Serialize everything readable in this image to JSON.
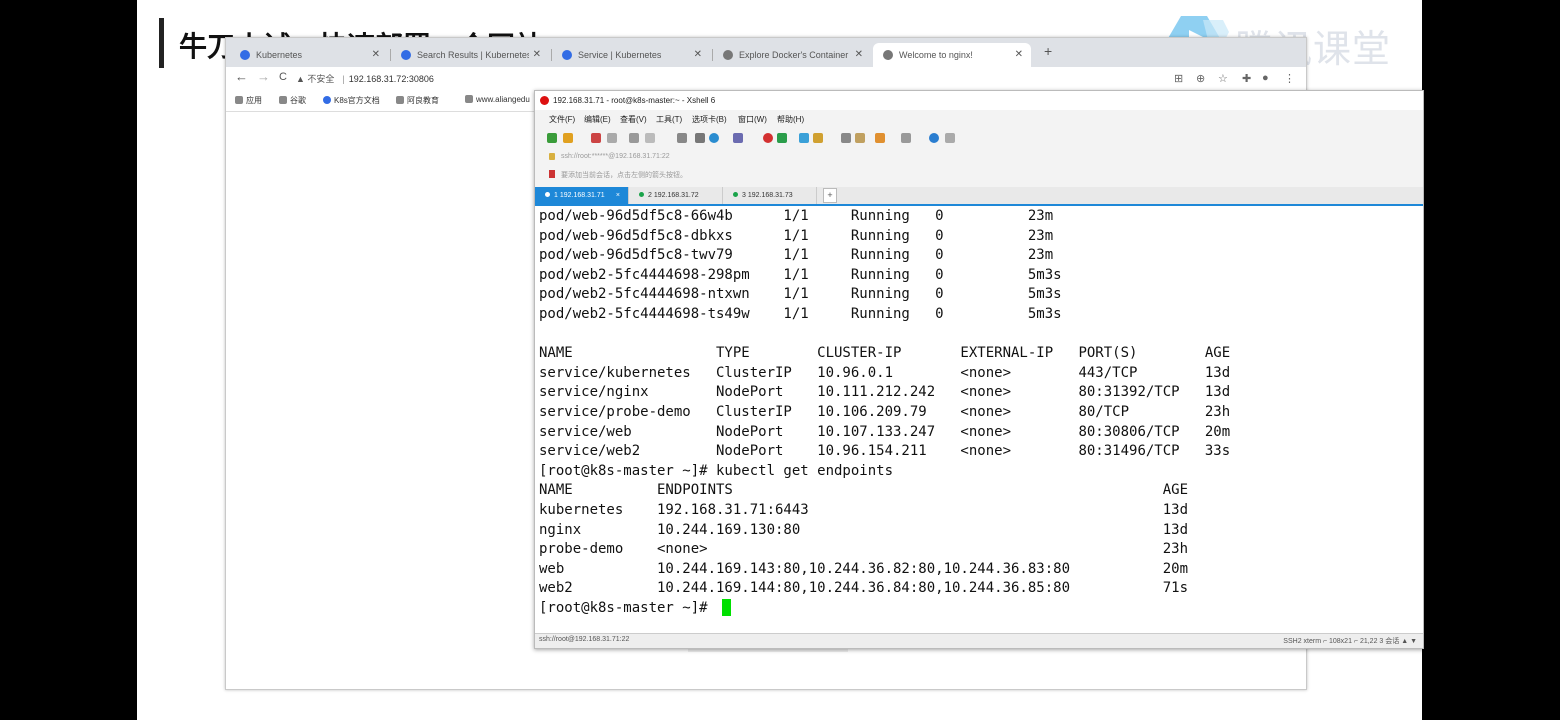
{
  "slide": {
    "title": "牛刀小试：快速部署一个网站",
    "brand": "腾讯课堂"
  },
  "browser": {
    "tabs": [
      {
        "label": "Kubernetes"
      },
      {
        "label": "Search Results | Kubernetes"
      },
      {
        "label": "Service | Kubernetes"
      },
      {
        "label": "Explore Docker's Container Im"
      },
      {
        "label": "Welcome to nginx!"
      }
    ],
    "new_tab": "+",
    "back": "←",
    "forward": "→",
    "reload": "C",
    "security": "▲ 不安全",
    "url": "192.168.31.72:30806",
    "bookmarks": [
      "应用",
      "谷歌",
      "K8s官方文档",
      "阿良教育",
      "www.aliangedu"
    ]
  },
  "xshell": {
    "title": "192.168.31.71 - root@k8s-master:~ - Xshell 6",
    "menu": [
      "文件(F)",
      "编辑(E)",
      "查看(V)",
      "工具(T)",
      "选项卡(B)",
      "窗口(W)",
      "帮助(H)"
    ],
    "address": "ssh://root:******@192.168.31.71:22",
    "quick": "要添加当前会话，点击左侧的箭头按钮。",
    "session_tabs": [
      {
        "label": "1 192.168.31.71",
        "close": "×"
      },
      {
        "label": "2 192.168.31.72"
      },
      {
        "label": "3 192.168.31.73"
      }
    ],
    "add_tab": "+",
    "terminal_lines": [
      "pod/web-96d5df5c8-66w4b      1/1     Running   0          23m",
      "pod/web-96d5df5c8-dbkxs      1/1     Running   0          23m",
      "pod/web-96d5df5c8-twv79      1/1     Running   0          23m",
      "pod/web2-5fc4444698-298pm    1/1     Running   0          5m3s",
      "pod/web2-5fc4444698-ntxwn    1/1     Running   0          5m3s",
      "pod/web2-5fc4444698-ts49w    1/1     Running   0          5m3s",
      "",
      "NAME                 TYPE        CLUSTER-IP       EXTERNAL-IP   PORT(S)        AGE",
      "service/kubernetes   ClusterIP   10.96.0.1        <none>        443/TCP        13d",
      "service/nginx        NodePort    10.111.212.242   <none>        80:31392/TCP   13d",
      "service/probe-demo   ClusterIP   10.106.209.79    <none>        80/TCP         23h",
      "service/web          NodePort    10.107.133.247   <none>        80:30806/TCP   20m",
      "service/web2         NodePort    10.96.154.211    <none>        80:31496/TCP   33s",
      "[root@k8s-master ~]# kubectl get endpoints",
      "NAME          ENDPOINTS                                                   AGE",
      "kubernetes    192.168.31.71:6443                                          13d",
      "nginx         10.244.169.130:80                                           13d",
      "probe-demo    <none>                                                      23h",
      "web           10.244.169.143:80,10.244.36.82:80,10.244.36.83:80           20m",
      "web2          10.244.169.144:80,10.244.36.84:80,10.244.36.85:80           71s",
      "[root@k8s-master ~]# "
    ],
    "status_left": "ssh://root@192.168.31.71:22",
    "status_right": "SSH2   xterm   ⌐ 108x21   ⌐ 21,22   3 会话   ▲ ▼"
  },
  "colors": {
    "cursor": "#00e000",
    "xshell_tab_active": "#1e88d8"
  }
}
